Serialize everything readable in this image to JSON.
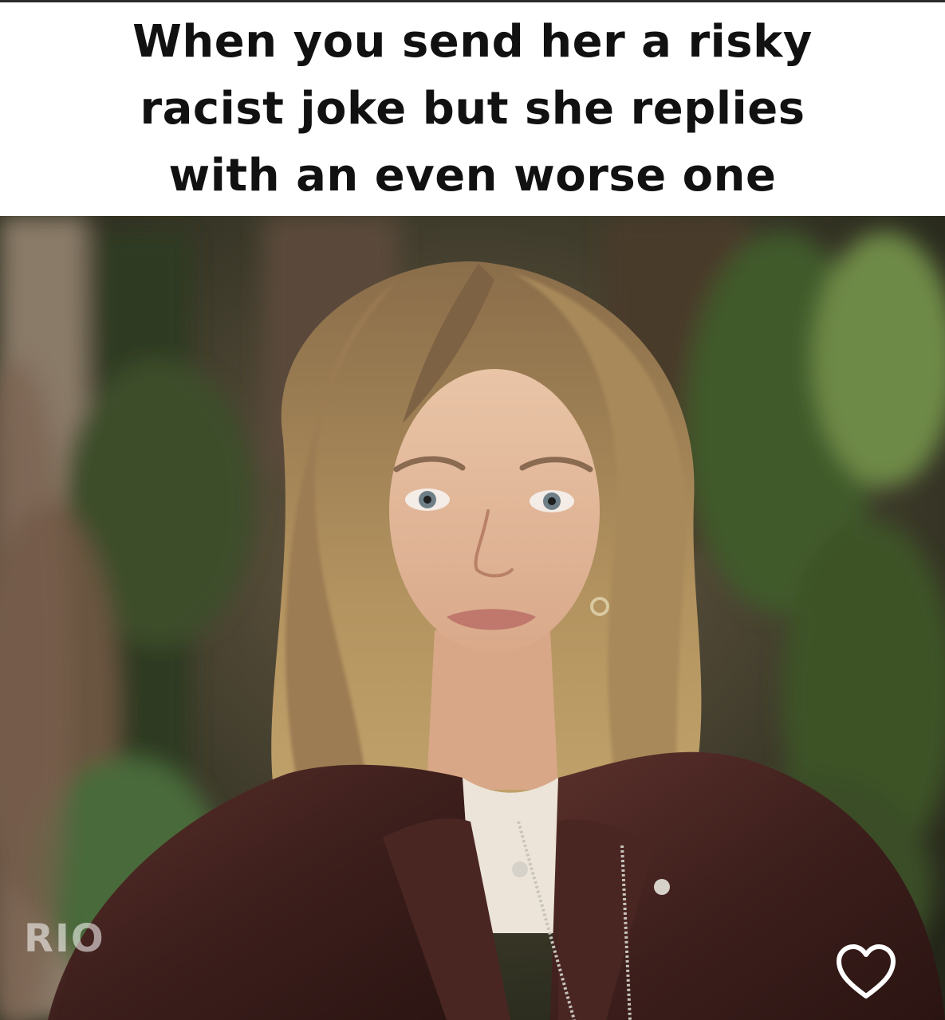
{
  "caption": {
    "lines": [
      "When you send her a risky",
      "racist joke but she replies",
      "with an even worse one"
    ]
  },
  "photo": {
    "subject": "woman with long wavy blonde-brown hair wearing a dark brown leather jacket and white top, foliage background"
  },
  "watermark": {
    "text": "RIO"
  },
  "icons": {
    "like": "heart-outline-icon"
  },
  "colors": {
    "caption_text": "#111111",
    "caption_bg": "#ffffff",
    "jacket": "#3d1f1c",
    "hair": "#a2855c",
    "foliage": "#556b3a"
  }
}
